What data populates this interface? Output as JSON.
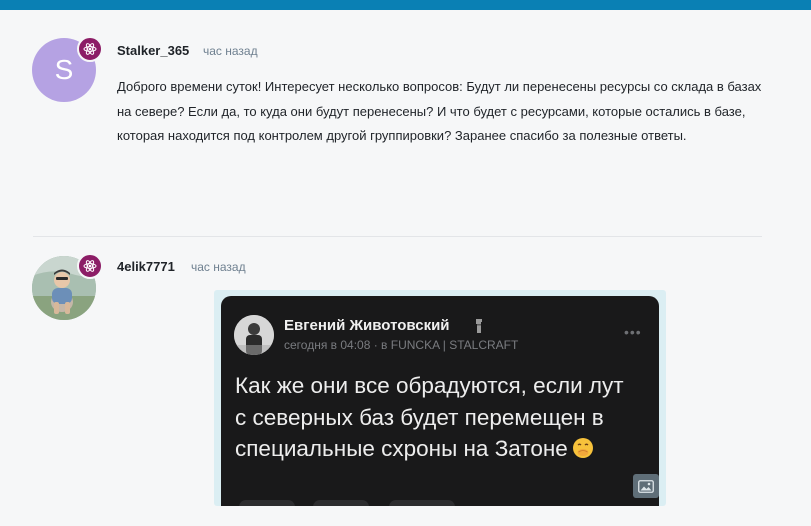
{
  "comments": [
    {
      "avatar_letter": "S",
      "author": "Stalker_365",
      "time": "час назад",
      "text": "Доброго времени суток! Интересует несколько вопросов: Будут ли перенесены ресурсы со склада в базах на севере? Если да, то куда они будут перенесены? И что будет с ресурсами, которые остались в базе, которая находится под контролем другой группировки? Заранее спасибо за полезные ответы."
    },
    {
      "author": "4elik7771",
      "time": "час назад",
      "embedded_post": {
        "author": "Евгений Животовский",
        "meta": "сегодня в 04:08 · в FUNCKA | STALCRAFT",
        "text": "Как же они все обрадуются, если лут с северных баз будет перемещен в специальные схроны на Затоне",
        "emoji": "smiling-face-with-hand-over-mouth",
        "menu": "•••"
      }
    }
  ],
  "colors": {
    "topbar": "#0a80b4",
    "badge": "#8c1d66",
    "avatar_letter_bg": "#b5a2e3",
    "link_muted": "#6f8090",
    "post_bg": "#19191a"
  },
  "icons": [
    "role-badge-icon",
    "user-photo-avatar",
    "image-icon",
    "more-dots-icon"
  ]
}
